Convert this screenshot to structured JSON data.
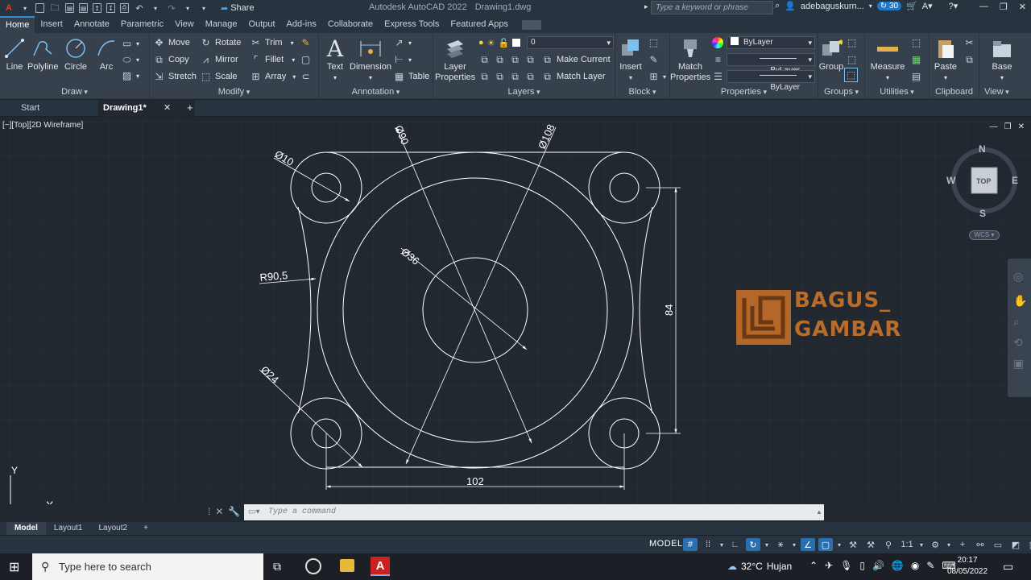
{
  "app": {
    "title": "Autodesk AutoCAD 2022",
    "doc": "Drawing1.dwg",
    "share_label": "Share",
    "search_placeholder": "Type a keyword or phrase",
    "user": "adebaguskurn...",
    "notif_count": "30"
  },
  "ribbon_tabs": [
    "Home",
    "Insert",
    "Annotate",
    "Parametric",
    "View",
    "Manage",
    "Output",
    "Add-ins",
    "Collaborate",
    "Express Tools",
    "Featured Apps"
  ],
  "draw": {
    "title": "Draw",
    "line": "Line",
    "polyline": "Polyline",
    "circle": "Circle",
    "arc": "Arc"
  },
  "modify": {
    "title": "Modify",
    "move": "Move",
    "rotate": "Rotate",
    "trim": "Trim",
    "copy": "Copy",
    "mirror": "Mirror",
    "fillet": "Fillet",
    "stretch": "Stretch",
    "scale": "Scale",
    "array": "Array"
  },
  "annotation": {
    "title": "Annotation",
    "text": "Text",
    "dimension": "Dimension",
    "table": "Table"
  },
  "layers": {
    "title": "Layers",
    "layer_properties": "Layer Properties",
    "current_layer": "0",
    "make_current": "Make Current",
    "match_layer": "Match Layer"
  },
  "block": {
    "title": "Block",
    "insert": "Insert"
  },
  "properties": {
    "title": "Properties",
    "match": "Match Properties",
    "color": "ByLayer",
    "linetype": "ByLayer",
    "lineweight": "ByLayer"
  },
  "groups": {
    "title": "Groups",
    "group": "Group"
  },
  "utilities": {
    "title": "Utilities",
    "measure": "Measure"
  },
  "clipboard": {
    "title": "Clipboard",
    "paste": "Paste"
  },
  "view": {
    "title": "View",
    "base": "Base"
  },
  "doc_tabs": {
    "start": "Start",
    "drawing": "Drawing1*"
  },
  "viewport": {
    "label": "[−][Top][2D Wireframe]"
  },
  "dims": {
    "d10": "Ø10",
    "d90": "Ø90",
    "d108": "Ø108",
    "d36": "Ø36",
    "r905": "R90,5",
    "d24": "Ø24",
    "v84": "84",
    "h102": "102"
  },
  "viewcube": {
    "n": "N",
    "s": "S",
    "e": "E",
    "w": "W",
    "top": "TOP",
    "wcs": "WCS"
  },
  "ucs": {
    "x": "X",
    "y": "Y"
  },
  "logo": {
    "line1": "BAGUS_",
    "line2": "GAMBAR"
  },
  "command": {
    "placeholder": "Type a command"
  },
  "layout_tabs": [
    "Model",
    "Layout1",
    "Layout2"
  ],
  "status": {
    "model": "MODEL",
    "scale": "1:1"
  },
  "taskbar": {
    "search": "Type here to search",
    "temp": "32°C",
    "weather": "Hujan",
    "time": "20:17",
    "date": "08/05/2022"
  }
}
